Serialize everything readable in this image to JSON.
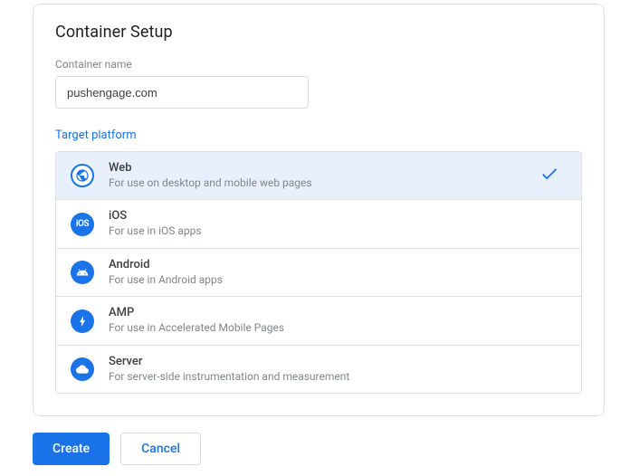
{
  "page_title": "Container Setup",
  "container_name": {
    "label": "Container name",
    "value": "pushengage.com"
  },
  "target_platform_label": "Target platform",
  "platforms": [
    {
      "title": "Web",
      "desc": "For use on desktop and mobile web pages",
      "selected": true
    },
    {
      "title": "iOS",
      "desc": "For use in iOS apps",
      "selected": false
    },
    {
      "title": "Android",
      "desc": "For use in Android apps",
      "selected": false
    },
    {
      "title": "AMP",
      "desc": "For use in Accelerated Mobile Pages",
      "selected": false
    },
    {
      "title": "Server",
      "desc": "For server-side instrumentation and measurement",
      "selected": false
    }
  ],
  "buttons": {
    "create": "Create",
    "cancel": "Cancel"
  }
}
